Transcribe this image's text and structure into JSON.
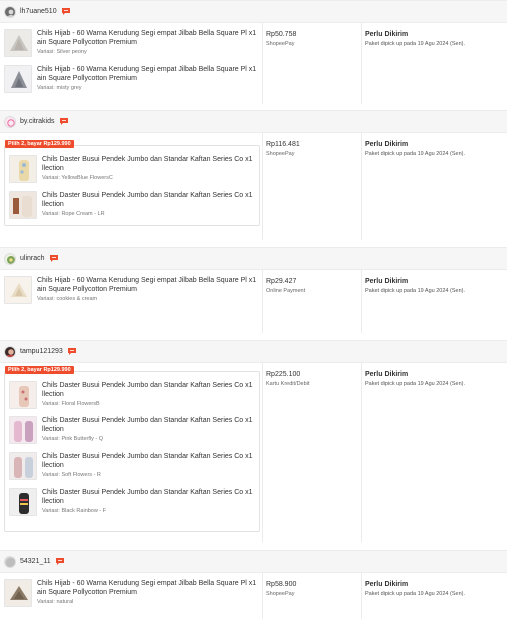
{
  "orders": [
    {
      "username": "lh7uane510",
      "price": "Rp50.758",
      "payment": "ShopeePay",
      "status": "Perlu Dikirim",
      "status_detail": "Paket dipick up pada 19 Agu 2024 (Sen).",
      "items": [
        {
          "name": "Chils Hijab - 60 Warna Kerudung Segi empat Jilbab Bella Square Pl x1 ain Square Pollycotton Premium",
          "variant": "Variasi: Silver peony"
        },
        {
          "name": "Chils Hijab - 60 Warna Kerudung Segi empat Jilbab Bella Square Pl x1 ain Square Pollycotton Premium",
          "variant": "Variasi: misty grey"
        }
      ]
    },
    {
      "username": "by.citrakids",
      "promo": "Pilih 2, bayar Rp129.990",
      "price": "Rp116.481",
      "payment": "ShopeePay",
      "status": "Perlu Dikirim",
      "status_detail": "Paket dipick up pada 19 Agu 2024 (Sen).",
      "items": [
        {
          "name": "Chils Daster Busui Pendek Jumbo dan Standar Kaftan Series Co x1 llection",
          "variant": "Variasi: YellowBlue FlowersC"
        },
        {
          "name": "Chils Daster Busui Pendek Jumbo dan Standar Kaftan Series Co x1 llection",
          "variant": "Variasi: Rope Cream - LR"
        }
      ]
    },
    {
      "username": "ulinrach",
      "price": "Rp29.427",
      "payment": "Online Payment",
      "status": "Perlu Dikirim",
      "status_detail": "Paket dipick up pada 19 Agu 2024 (Sen).",
      "items": [
        {
          "name": "Chils Hijab - 60 Warna Kerudung Segi empat Jilbab Bella Square Pl x1 ain Square Pollycotton Premium",
          "variant": "Variasi: cookies & cream"
        }
      ]
    },
    {
      "username": "tampu121293",
      "promo": "Pilih 2, bayar Rp129.990",
      "price": "Rp225.100",
      "payment": "Kartu Kredit/Debit",
      "status": "Perlu Dikirim",
      "status_detail": "Paket dipick up pada 19 Agu 2024 (Sen).",
      "items": [
        {
          "name": "Chils Daster Busui Pendek Jumbo dan Standar Kaftan Series Co x1 llection",
          "variant": "Variasi: Floral FlowersB"
        },
        {
          "name": "Chils Daster Busui Pendek Jumbo dan Standar Kaftan Series Co x1 llection",
          "variant": "Variasi: Pink Butterfly - Q"
        },
        {
          "name": "Chils Daster Busui Pendek Jumbo dan Standar Kaftan Series Co x1 llection",
          "variant": "Variasi: Soft Flowers - R"
        },
        {
          "name": "Chils Daster Busui Pendek Jumbo dan Standar Kaftan Series Co x1 llection",
          "variant": "Variasi: Black Rainbow - F"
        }
      ]
    },
    {
      "username": "54321_11",
      "price": "Rp58.900",
      "payment": "ShopeePay",
      "status": "Perlu Dikirim",
      "status_detail": "Paket dipick up pada 19 Agu 2024 (Sen).",
      "items": [
        {
          "name": "Chils Hijab - 60 Warna Kerudung Segi empat Jilbab Bella Square Pl x1 ain Square Pollycotton Premium",
          "variant": "Variasi: natural"
        }
      ]
    }
  ]
}
